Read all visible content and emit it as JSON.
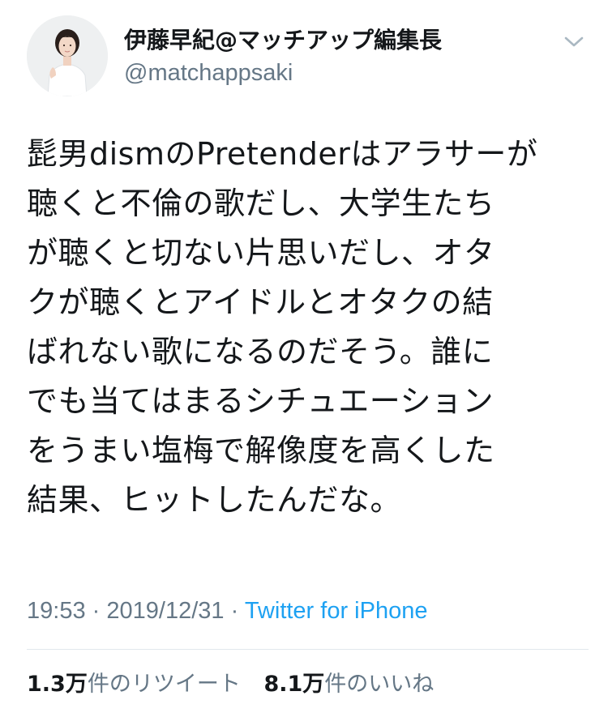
{
  "author": {
    "display_name": "伊藤早紀@マッチアップ編集長",
    "handle": "@matchappsaki",
    "avatar_icon": "profile-photo-avatar"
  },
  "menu": {
    "icon": "chevron-down-icon"
  },
  "tweet": {
    "lines": [
      "髭男dismのPretenderはアラサーが",
      "聴くと不倫の歌だし、大学生たち",
      "が聴くと切ない片思いだし、オタ",
      "クが聴くとアイドルとオタクの結",
      "ばれない歌になるのだそう。誰に",
      "でも当てはまるシチュエーション",
      "をうまい塩梅で解像度を高くした",
      "結果、ヒットしたんだな。"
    ]
  },
  "meta": {
    "time": "19:53",
    "separator": "·",
    "date": "2019/12/31",
    "source": "Twitter for iPhone"
  },
  "stats": {
    "retweets_count": "1.3万",
    "retweets_label": "件のリツイート",
    "likes_count": "8.1万",
    "likes_label": "件のいいね"
  },
  "colors": {
    "text": "#14171a",
    "secondary": "#657786",
    "link": "#1da1f2",
    "divider": "#e1e8ed"
  }
}
